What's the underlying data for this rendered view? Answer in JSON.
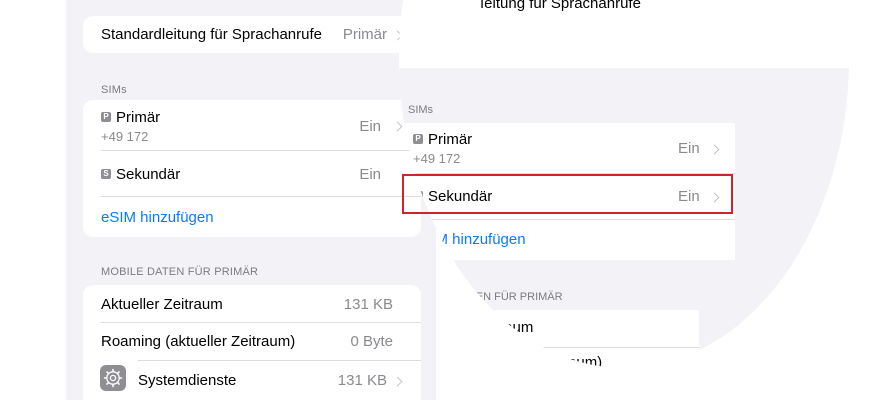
{
  "left_pane": {
    "default_line": {
      "label": "Standardleitung für Sprachanrufe",
      "value": "Primär"
    },
    "sims_header": "SIMs",
    "sims": [
      {
        "badge": "P",
        "label": "Primär",
        "number": "+49 172",
        "value": "Ein"
      },
      {
        "badge": "S",
        "label": "Sekundär",
        "value": "Ein"
      }
    ],
    "add_esim": "eSIM hinzufügen",
    "mobile_data_header": "MOBILE DATEN FÜR PRIMÄR",
    "mobile_data": [
      {
        "label": "Aktueller Zeitraum",
        "value": "131 KB"
      },
      {
        "label": "Roaming (aktueller Zeitraum)",
        "value": "0 Byte"
      },
      {
        "icon": "gear-icon",
        "label": "Systemdienste",
        "value": "131 KB"
      }
    ]
  },
  "zoom": {
    "default_line_partial": "ıeitung für Sprachanrufe",
    "sims_header_partial": "SIMs",
    "sims": [
      {
        "badge": "P",
        "label": "Primär",
        "number": "+49 172",
        "value": "Ein"
      },
      {
        "badge": "S",
        "label": "Sekundär",
        "value": "Ein"
      }
    ],
    "add_esim": "eSIM hinzufügen",
    "mobile_data_header_partial": "MOBILE DATEN FÜR PRIMÄR",
    "row_partial_1": "ller Zeitraum",
    "row_partial_2": "ıler Zeitraum)"
  },
  "colors": {
    "highlight": "#d0232a",
    "link": "#0a7aff",
    "background": "#f2f2f7"
  }
}
